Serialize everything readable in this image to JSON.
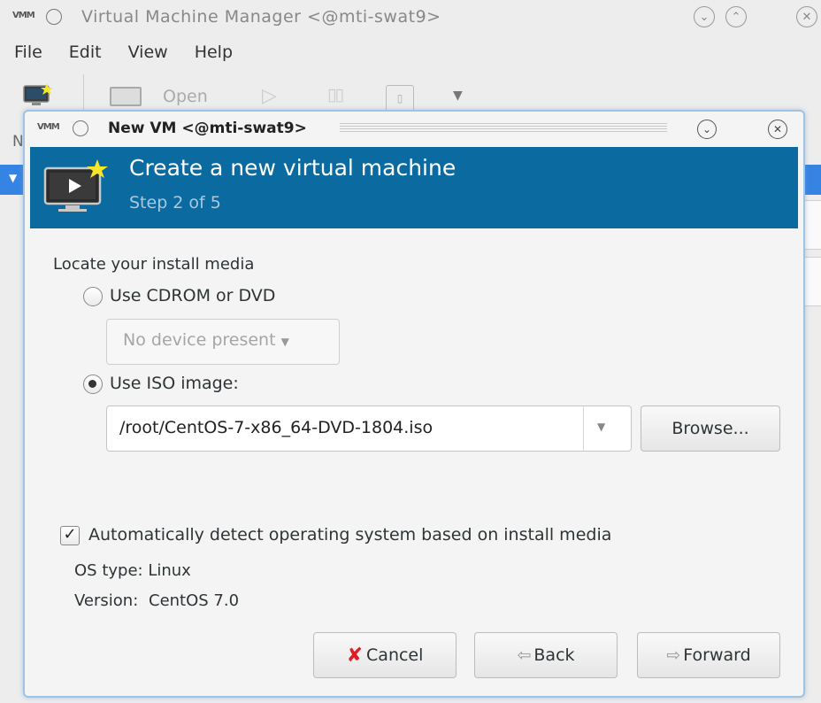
{
  "main_window": {
    "title": "Virtual Machine Manager <@mti-swat9>",
    "menu": [
      "File",
      "Edit",
      "View",
      "Help"
    ],
    "toolbar": {
      "open_label": "Open"
    },
    "list_partial_header": "N"
  },
  "dialog": {
    "title": "New VM <@mti-swat9>",
    "banner_title": "Create a new virtual machine",
    "step": "Step 2 of 5",
    "section_label": "Locate your install media",
    "cdrom_option": "Use CDROM or DVD",
    "cdrom_selected": false,
    "device_placeholder": "No device present",
    "iso_option": "Use ISO image:",
    "iso_selected": true,
    "iso_path": "/root/CentOS-7-x86_64-DVD-1804.iso",
    "browse_label": "Browse...",
    "auto_detect_label": "Automatically detect operating system based on install media",
    "auto_detect_checked": true,
    "os_type_label": "OS type:",
    "os_type_value": "Linux",
    "version_label": "Version:",
    "version_value": "CentOS 7.0",
    "buttons": {
      "cancel": "Cancel",
      "back": "Back",
      "forward": "Forward"
    }
  },
  "colors": {
    "banner": "#0b6aa0",
    "selection": "#3584e4",
    "dialog_border": "#9ec3e4",
    "cancel_icon": "#e01b24"
  }
}
